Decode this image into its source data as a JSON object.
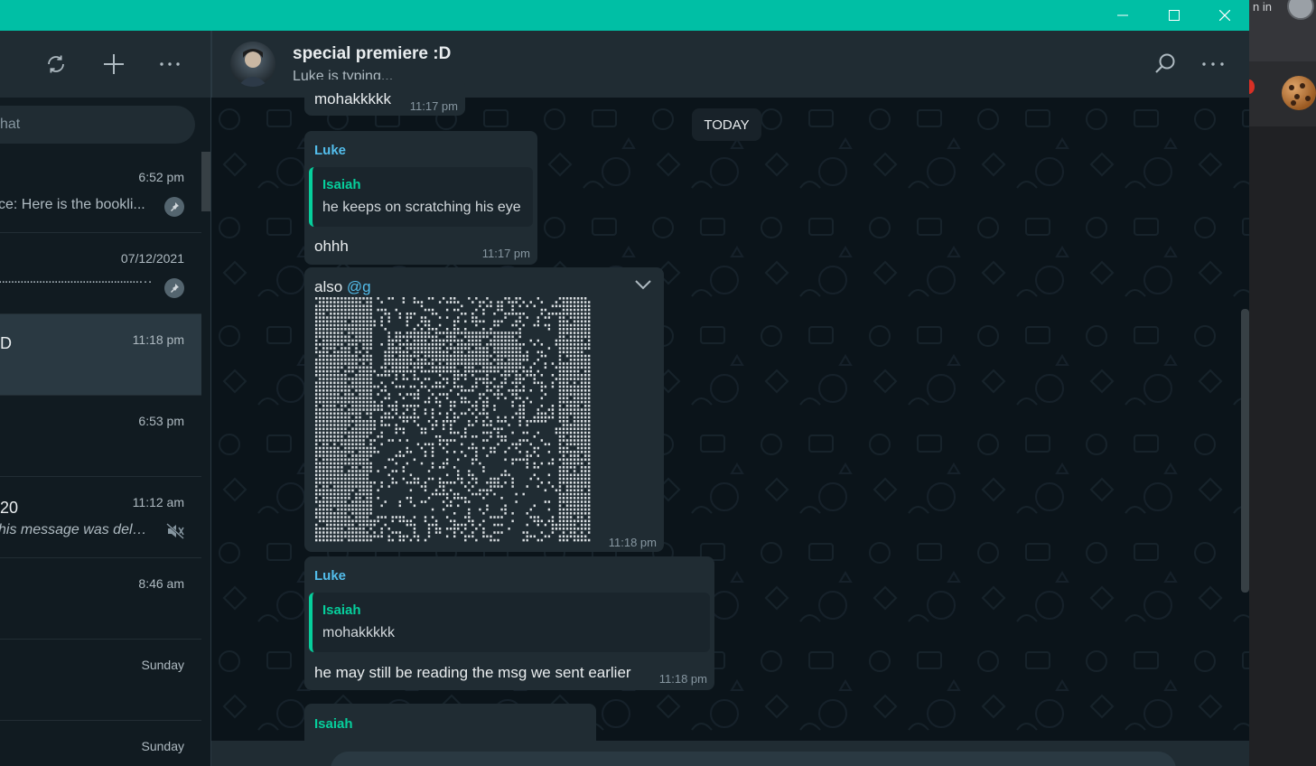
{
  "window": {
    "minimize_label": "minimize",
    "maximize_label": "maximize",
    "close_label": "close",
    "accent": "#00bfa5"
  },
  "browser_behind": {
    "signin_text": "n in"
  },
  "sidebar": {
    "icons": [
      "refresh-icon",
      "new-chat-icon",
      "menu-icon"
    ],
    "search_placeholder": "hat",
    "chats": [
      {
        "name": "",
        "time": "6:52 pm",
        "preview": "ce: Here is the bookli...",
        "pinned": true
      },
      {
        "name": "",
        "time": "07/12/2021",
        "preview": "........................................................",
        "pinned": true
      },
      {
        "name": "D",
        "time": "11:18 pm",
        "preview": "",
        "active": true
      },
      {
        "name": "",
        "time": "6:53 pm",
        "preview": ""
      },
      {
        "name": "20",
        "time": "11:12 am",
        "preview": "his message was delet...",
        "muted": true,
        "italic": true
      },
      {
        "name": "",
        "time": "8:46 am",
        "preview": ""
      },
      {
        "name": "",
        "time": "Sunday",
        "preview": ""
      },
      {
        "name": "",
        "time": "Sunday",
        "preview": ""
      }
    ]
  },
  "chat": {
    "title": "special premiere :D",
    "status": "Luke is typing...",
    "today_label": "TODAY",
    "messages": {
      "m0": {
        "text": "mohakkkkk",
        "time": "11:17 pm"
      },
      "m1": {
        "sender": "Luke",
        "quote_author": "Isaiah",
        "quote_text": "he keeps on scratching his eye",
        "text": "ohhh",
        "time": "11:17 pm"
      },
      "m2": {
        "text_prefix": "also ",
        "mention": "@g",
        "time": "11:18 pm"
      },
      "m3": {
        "sender": "Luke",
        "quote_author": "Isaiah",
        "quote_text": "mohakkkkk",
        "text": "he may still be reading the msg we sent earlier",
        "time": "11:18 pm"
      },
      "m4": {
        "sender": "Isaiah"
      }
    },
    "colors": {
      "luke": "#53bdeb",
      "isaiah": "#06cf9c",
      "bubble": "#202c33",
      "background": "#0b141a"
    }
  }
}
